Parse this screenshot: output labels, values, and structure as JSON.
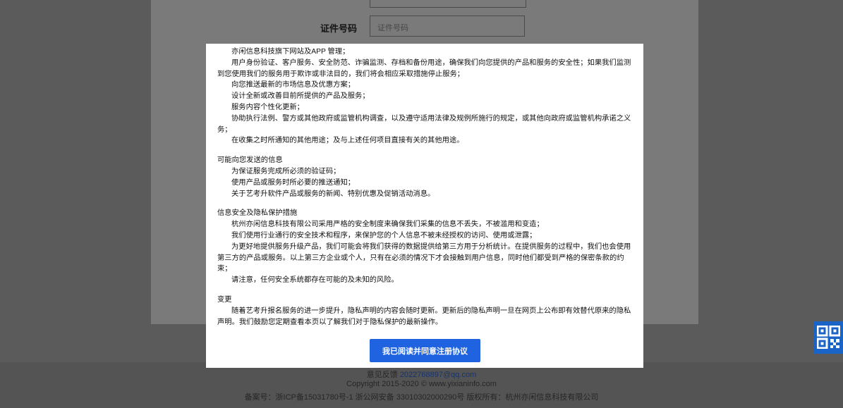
{
  "background_form": {
    "id_label": "证件号码",
    "id_placeholder": "证件号码"
  },
  "modal": {
    "sections": [
      {
        "title": "",
        "paragraphs": [
          "亦闲信息科技旗下网站及APP 管理；",
          "用户身份验证、客户服务、安全防范、诈骗监测、存档和备份用途，确保我们向您提供的产品和服务的安全性；如果我们监测到您使用我们的服务用于欺诈或非法目的，我们将会相应采取措施停止服务；",
          "向您推送最新的市场信息及优惠方案；",
          "设计全新或改善目前所提供的产品及服务；",
          "服务内容个性化更新；",
          "协助执行法例、警方或其他政府或监管机构调查，以及遵守适用法律及规例所施行的规定，或其他向政府或监管机构承诺之义务；",
          "在收集之时所通知的其他用途；及与上述任何项目直接有关的其他用途。"
        ]
      },
      {
        "title": "可能向您发送的信息",
        "paragraphs": [
          "为保证服务完成所必须的验证码；",
          "使用产品或服务时所必要的推送通知；",
          "关于艺考升软件产品或服务的新闻、特别优惠及促销活动消息。"
        ]
      },
      {
        "title": "信息安全及隐私保护措施",
        "paragraphs": [
          "杭州亦闲信息科技有限公司采用严格的安全制度来确保我们采集的信息不丢失，不被滥用和变造；",
          "我们使用行业通行的安全技术和程序，来保护您的个人信息不被未经授权的访问、使用或泄露；",
          "为更好地提供服务升级产品，我们可能会将我们获得的数据提供给第三方用于分析统计。在提供服务的过程中，我们也会使用第三方的产品或服务。以上第三方企业或个人，只有在必须的情况下才会接触到用户信息，同时他们都受到严格的保密条款的约束；",
          "请注意，任何安全系统都存在可能的及未知的风险。"
        ]
      },
      {
        "title": "变更",
        "paragraphs": [
          "随着艺考升报名服务的进一步提升，隐私声明的内容会随时更新。更新后的隐私声明一旦在网页上公布即有效替代原来的隐私声明。我们鼓励您定期查看本页以了解我们对于隐私保护的最新操作。"
        ]
      }
    ],
    "agree_button": "我已阅读并同意注册协议"
  },
  "footer": {
    "feedback_label": "意见反馈",
    "feedback_email": "2022768897@qq.com",
    "copyright": "Copyright  2015-2020 © www.yixianinfo.com",
    "record": "备案号：浙ICP备15031780号-1    浙公网安备 33010302000290号    版权所有：杭州亦闲信息科技有限公司"
  },
  "colors": {
    "overlay": "#5b5b5b",
    "modal_bg": "#ffffff",
    "button": "#1f63e0",
    "qr_badge": "#1a64c8"
  },
  "icons": {
    "qr": "qr-code-icon"
  }
}
